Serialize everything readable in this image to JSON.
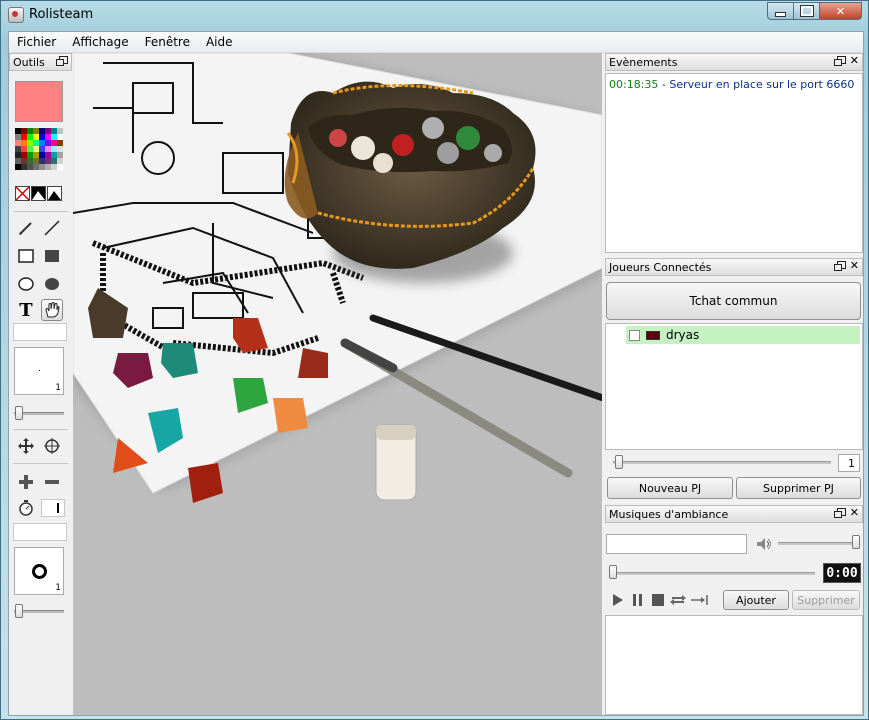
{
  "window": {
    "title": "Rolisteam"
  },
  "menu": [
    "Fichier",
    "Affichage",
    "Fenêtre",
    "Aide"
  ],
  "tools_panel": {
    "title": "Outils",
    "current_color": "#ff8080",
    "palette": [
      "#000000",
      "#800000",
      "#008000",
      "#808000",
      "#000080",
      "#800080",
      "#008080",
      "#c0c0c0",
      "#808080",
      "#ff0000",
      "#00ff00",
      "#ffff00",
      "#0000ff",
      "#ff00ff",
      "#00ffff",
      "#ffffff",
      "#ff8080",
      "#ff8000",
      "#80ff00",
      "#00ff80",
      "#0080ff",
      "#8000ff",
      "#ff0080",
      "#804000",
      "#404040",
      "#ff4040",
      "#40ff40",
      "#ffff80",
      "#4040ff",
      "#ff80ff",
      "#80ffff",
      "#e0e0e0",
      "#202020",
      "#a00000",
      "#00a000",
      "#a0a000",
      "#0000a0",
      "#a000a0",
      "#00a0a0",
      "#a0a0a0",
      "#606060",
      "#703030",
      "#307030",
      "#707030",
      "#303070",
      "#703070",
      "#307070",
      "#d0d0d0",
      "#000000",
      "#303030",
      "#505050",
      "#707070",
      "#909090",
      "#b0b0b0",
      "#d0d0d0",
      "#ffffff"
    ],
    "pen_size_count": "1",
    "npc_size_count": "1"
  },
  "events_panel": {
    "title": "Evènements",
    "entries": [
      {
        "time": "00:18:35",
        "text": " - Serveur en place sur le port 6660"
      }
    ]
  },
  "players_panel": {
    "title": "Joueurs Connectés",
    "chat_button": "Tchat commun",
    "players": [
      {
        "name": "dryas",
        "color": "#5c0010"
      }
    ],
    "spin_value": "1",
    "new_pc": "Nouveau PJ",
    "delete_pc": "Supprimer PJ"
  },
  "music_panel": {
    "title": "Musiques d'ambiance",
    "track_title": "",
    "time_display": "0:00",
    "add": "Ajouter",
    "delete": "Supprimer"
  }
}
